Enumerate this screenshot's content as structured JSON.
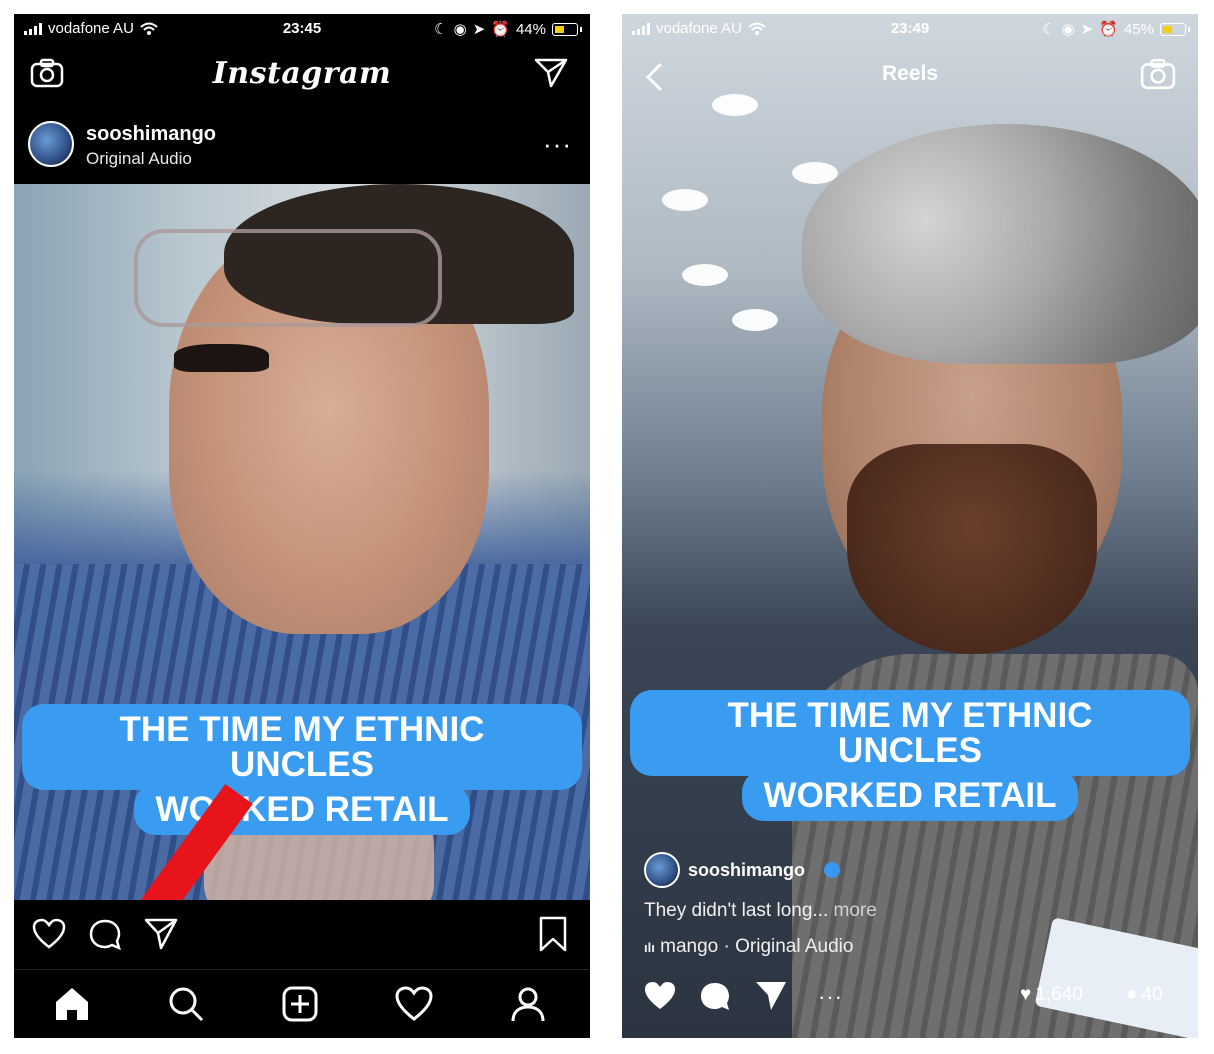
{
  "left": {
    "status": {
      "carrier": "vodafone AU",
      "time": "23:45",
      "battery": "44%"
    },
    "header": {
      "logo": "Instagram"
    },
    "post": {
      "username": "sooshimango",
      "audio": "Original Audio"
    },
    "caption": {
      "line1": "THE TIME MY ETHNIC UNCLES",
      "line2": "WORKED RETAIL"
    }
  },
  "right": {
    "status": {
      "carrier": "vodafone AU",
      "time": "23:49",
      "battery": "45%"
    },
    "header": {
      "title": "Reels"
    },
    "caption": {
      "line1": "THE TIME MY ETHNIC UNCLES",
      "line2": "WORKED RETAIL"
    },
    "reel": {
      "username": "sooshimango",
      "description": "They didn't last long...",
      "more": "more",
      "audio_prefix": "mango",
      "audio_sep": "·",
      "audio_name": "Original Audio",
      "likes": "1,640",
      "comments": "40"
    }
  },
  "colors": {
    "caption_bubble": "#3a9cf0",
    "arrow": "#e8141c",
    "verified": "#3897f0"
  }
}
